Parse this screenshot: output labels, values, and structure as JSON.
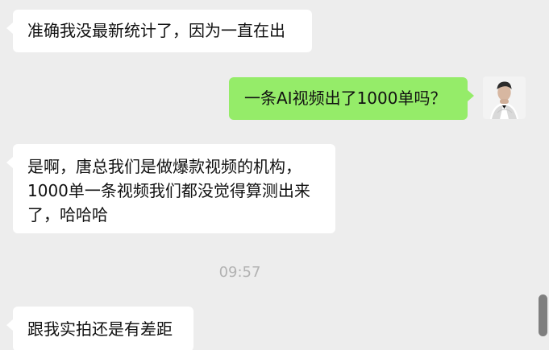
{
  "conversation": {
    "messages": [
      {
        "side": "incoming",
        "text": "准确我没最新统计了，因为一直在出"
      },
      {
        "side": "outgoing",
        "text": "一条AI视频出了1000单吗？"
      },
      {
        "side": "incoming",
        "text": "是啊，唐总我们是做爆款视频的机构，1000单一条视频我们都没觉得算测出来了，哈哈哈"
      },
      {
        "side": "incoming",
        "text": "跟我实拍还是有差距"
      }
    ],
    "timestamp": "09:57"
  },
  "colors": {
    "background": "#ededed",
    "incoming_bubble": "#ffffff",
    "outgoing_bubble": "#95ec69",
    "timestamp_text": "#b2b2b2",
    "scrollbar": "#7f7f7f"
  },
  "avatar": {
    "icon": "user-avatar-icon"
  }
}
